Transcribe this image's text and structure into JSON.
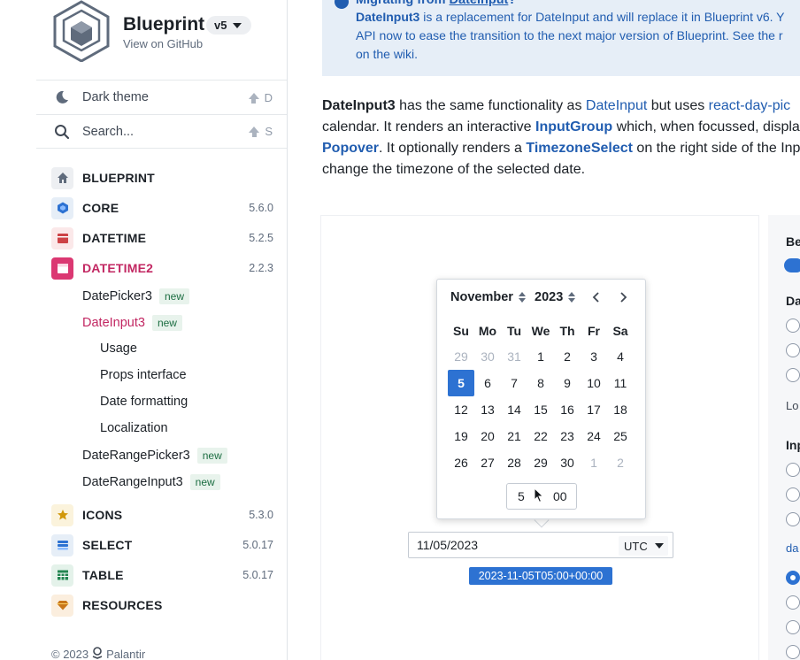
{
  "brand": {
    "title": "Blueprint",
    "subtitle": "View on GitHub",
    "version": "v5"
  },
  "toolbar": {
    "dark_theme_label": "Dark theme",
    "dark_theme_hotkey": "D",
    "search_placeholder": "Search...",
    "search_hotkey": "S"
  },
  "packages": [
    {
      "name": "BLUEPRINT",
      "version": "",
      "icon": "home-icon",
      "color": "#5f6b7c"
    },
    {
      "name": "CORE",
      "version": "5.6.0",
      "icon": "cube-icon",
      "color": "#2d72d2"
    },
    {
      "name": "DATETIME",
      "version": "5.2.5",
      "icon": "calendar-icon",
      "color": "#cd4246"
    },
    {
      "name": "DATETIME2",
      "version": "2.2.3",
      "icon": "calendar-icon",
      "color": "#c22762"
    },
    {
      "name": "ICONS",
      "version": "5.3.0",
      "icon": "star-icon",
      "color": "#d1980b"
    },
    {
      "name": "SELECT",
      "version": "5.0.17",
      "icon": "list-icon",
      "color": "#2d72d2"
    },
    {
      "name": "TABLE",
      "version": "5.0.17",
      "icon": "table-icon",
      "color": "#238551"
    },
    {
      "name": "RESOURCES",
      "version": "",
      "icon": "diamond-icon",
      "color": "#c87619"
    }
  ],
  "subnav": {
    "datepicker3": "DatePicker3",
    "dateinput3": "DateInput3",
    "usage": "Usage",
    "props": "Props interface",
    "formatting": "Date formatting",
    "localization": "Localization",
    "daterangepicker3": "DateRangePicker3",
    "daterangeinput3": "DateRangeInput3",
    "new_tag": "new"
  },
  "footer": {
    "copyright": "© 2023",
    "company": "Palantir"
  },
  "callout": {
    "title_prefix": "Migrating from ",
    "title_link": "DateInput",
    "title_suffix": "?",
    "line1_bold": "DateInput3",
    "line1_rest": " is a replacement for DateInput and will replace it in Blueprint v6. Y",
    "line2": "API now to ease the transition to the next major version of Blueprint. See the r",
    "line3": "on the wiki."
  },
  "paragraph": {
    "l1_bold": "DateInput3",
    "l1_a": " has the same functionality as ",
    "l1_link1": "DateInput",
    "l1_b": " but uses ",
    "l1_link2": "react-day-pic",
    "l2_a": "calendar. It renders an interactive ",
    "l2_link": "InputGroup",
    "l2_b": " which, when focussed, displa",
    "l3_link1": "Popover",
    "l3_a": ". It optionally renders a ",
    "l3_link2": "TimezoneSelect",
    "l3_b": " on the right side of the Inp",
    "l4": "change the timezone of the selected date."
  },
  "calendar": {
    "month": "November",
    "year": "2023",
    "weekdays": [
      "Su",
      "Mo",
      "Tu",
      "We",
      "Th",
      "Fr",
      "Sa"
    ],
    "weeks": [
      [
        "29",
        "30",
        "31",
        "1",
        "2",
        "3",
        "4"
      ],
      [
        "5",
        "6",
        "7",
        "8",
        "9",
        "10",
        "11"
      ],
      [
        "12",
        "13",
        "14",
        "15",
        "16",
        "17",
        "18"
      ],
      [
        "19",
        "20",
        "21",
        "22",
        "23",
        "24",
        "25"
      ],
      [
        "26",
        "27",
        "28",
        "29",
        "30",
        "1",
        "2"
      ]
    ],
    "selected_day": "5",
    "time_hour": "5",
    "time_minute": "00"
  },
  "date_input": {
    "value": "11/05/2023",
    "timezone": "UTC"
  },
  "iso_output": "2023-11-05T05:00+00:00",
  "options_panel": {
    "heading1": "Be",
    "heading2": "Da",
    "label_lo": "Lo",
    "heading3": "Inp",
    "link": "da"
  },
  "colors": {
    "accent": "#2d72d2",
    "active_nav": "#c22762",
    "link": "#215db0"
  }
}
